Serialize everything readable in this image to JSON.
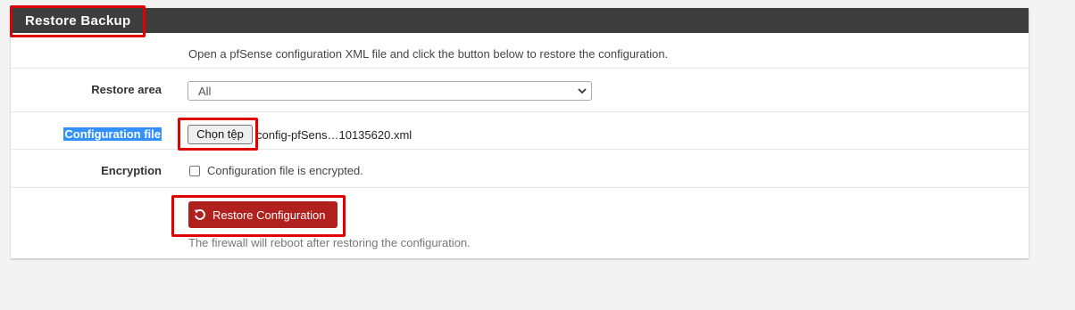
{
  "panel": {
    "title": "Restore Backup"
  },
  "intro_text": "Open a pfSense configuration XML file and click the button below to restore the configuration.",
  "restore_area": {
    "label": "Restore area",
    "selected": "All"
  },
  "config_file": {
    "label": "Configuration file",
    "button_label": "Chọn tệp",
    "file_name": "config-pfSens…10135620.xml"
  },
  "encryption": {
    "label": "Encryption",
    "checkbox_label": "Configuration file is encrypted.",
    "checked": false
  },
  "restore_button": {
    "label": "Restore Configuration",
    "icon": "undo-icon",
    "color": "#b0201d"
  },
  "help_text": "The firewall will reboot after restoring the configuration.",
  "colors": {
    "header_bg": "#3d3d3d",
    "highlight": "#e00000",
    "selection": "#3390ff"
  }
}
